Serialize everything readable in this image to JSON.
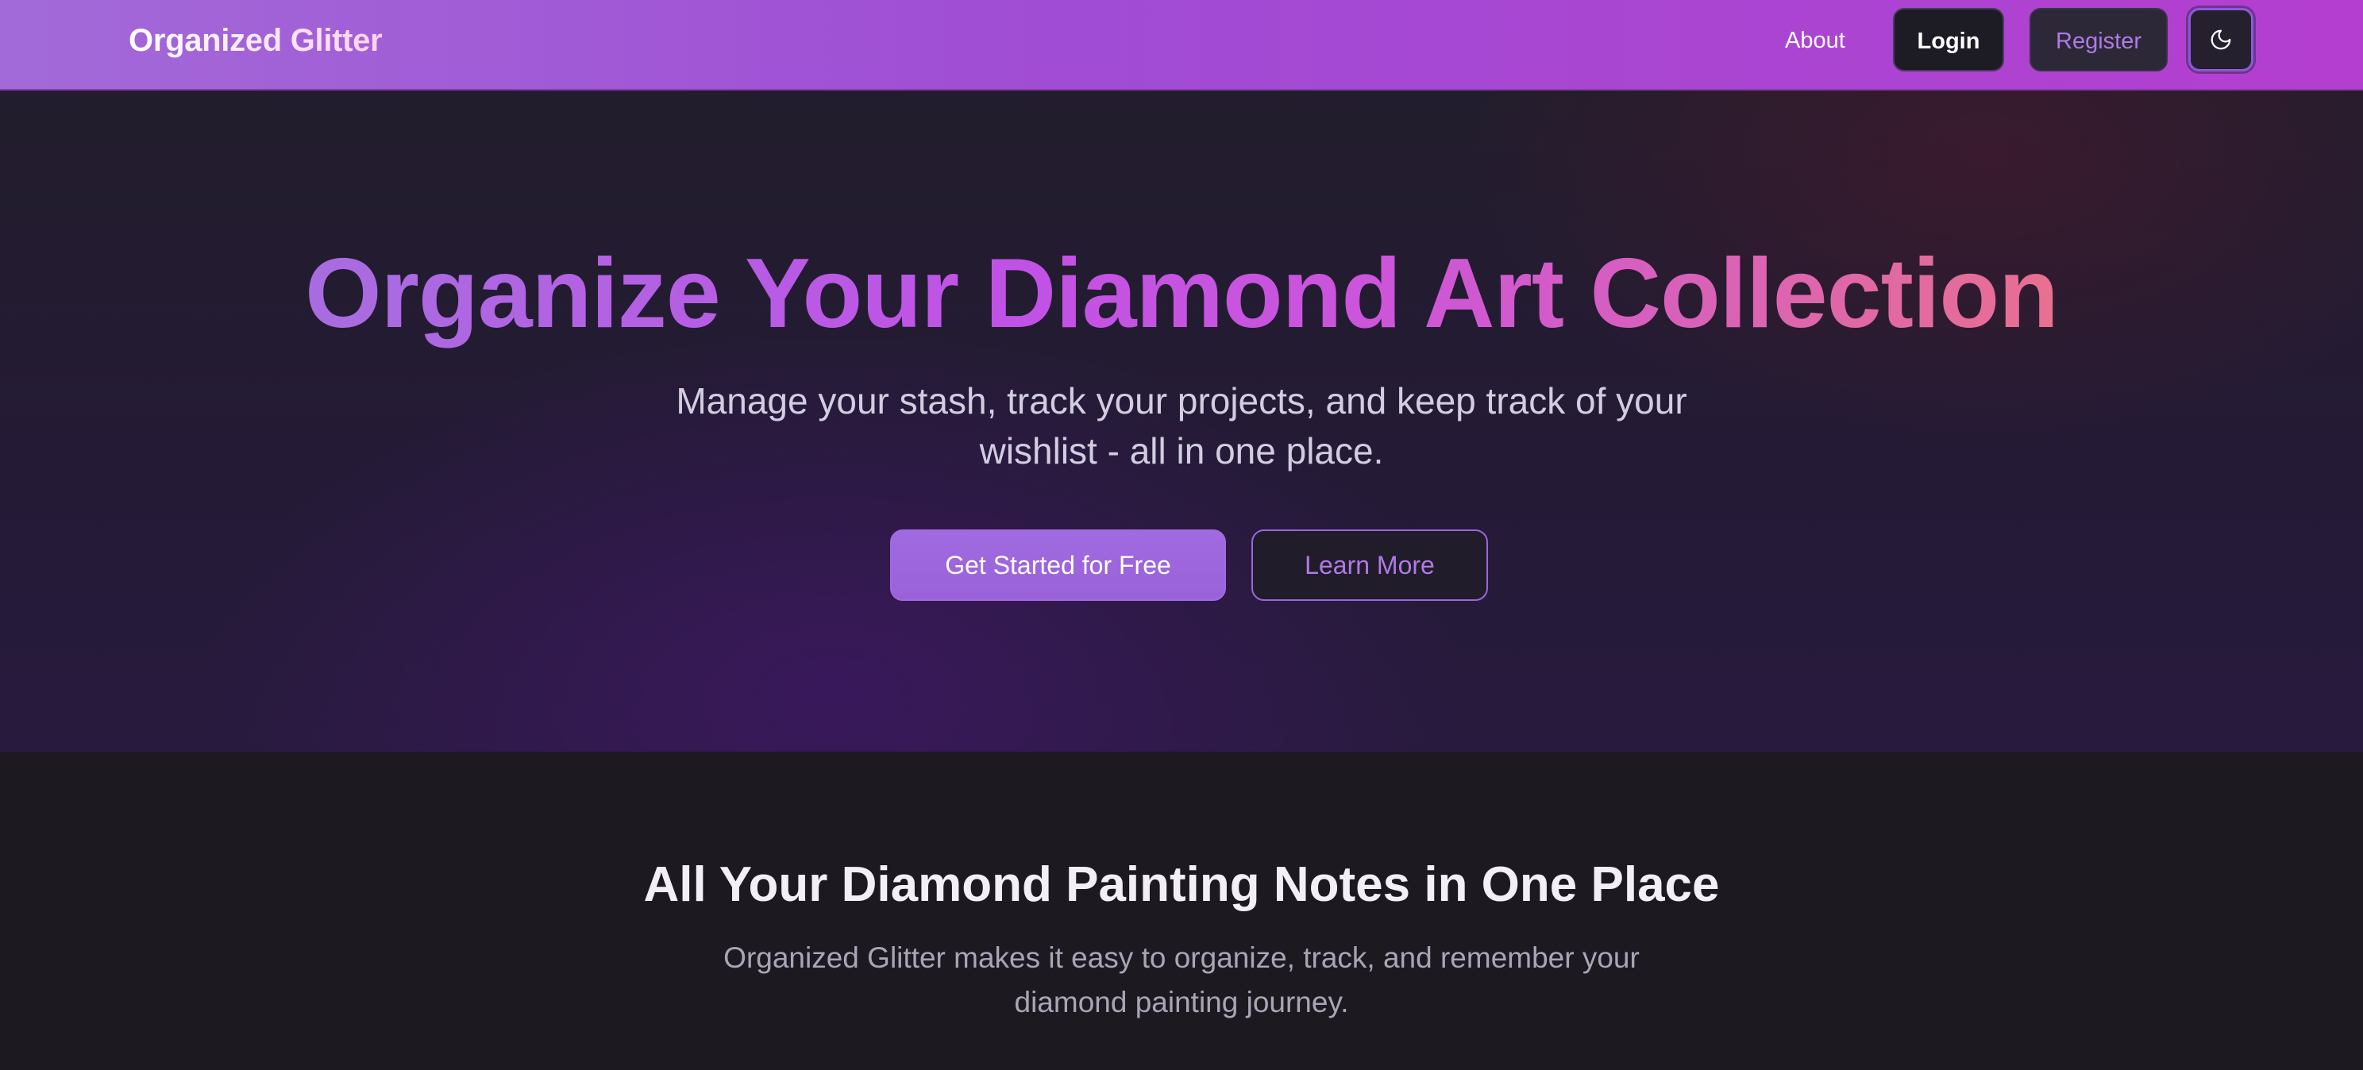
{
  "navbar": {
    "brand": "Organized Glitter",
    "about_label": "About",
    "login_label": "Login",
    "register_label": "Register",
    "theme_toggle_icon": "moon-icon"
  },
  "hero": {
    "title": "Organize Your Diamond Art Collection",
    "subtitle": "Manage your stash, track your projects, and keep track of your wishlist - all in one place.",
    "primary_button_label": "Get Started for Free",
    "secondary_button_label": "Learn More"
  },
  "features": {
    "title": "All Your Diamond Painting Notes in One Place",
    "subtitle": "Organized Glitter makes it easy to organize, track, and remember your diamond painting journey."
  },
  "colors": {
    "navbar_gradient_start": "#a26ad8",
    "navbar_gradient_end": "#b43ed0",
    "accent_purple": "#a06ae0",
    "title_gradient_end": "#e87090",
    "page_background": "#1c1a20"
  }
}
